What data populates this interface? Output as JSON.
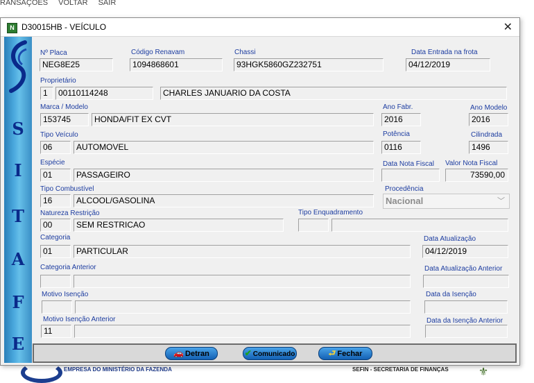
{
  "top_menu": [
    "RANSAÇÕES",
    "VOLTAR",
    "SAIR"
  ],
  "footer": {
    "left_text": "EMPRESA DO MINISTÉRIO DA FAZENDA",
    "right_text": "SEFIN - SECRETARIA DE FINANÇAS"
  },
  "window": {
    "icon_letter": "N",
    "title": "D30015HB - VEÍCULO",
    "close_symbol": "✕"
  },
  "sidebar": {
    "letters": [
      "S",
      "I",
      "T",
      "A",
      "F",
      "E"
    ]
  },
  "form": {
    "placa": {
      "label": "Nº Placa",
      "value": "NEG8E25"
    },
    "renavam": {
      "label": "Código Renavam",
      "value": "1094868601"
    },
    "chassi": {
      "label": "Chassi",
      "value": "93HGK5860GZ232751"
    },
    "data_entrada": {
      "label": "Data Entrada na frota",
      "value": "04/12/2019"
    },
    "proprietario": {
      "label": "Proprietário",
      "tipo": "1",
      "codigo": "00110114248",
      "nome": "CHARLES JANUARIO DA COSTA"
    },
    "marca_modelo": {
      "label": "Marca / Modelo",
      "codigo": "153745",
      "descricao": "HONDA/FIT EX CVT"
    },
    "ano_fabr": {
      "label": "Ano Fabr.",
      "value": "2016"
    },
    "ano_modelo": {
      "label": "Ano Modelo",
      "value": "2016"
    },
    "tipo_veiculo": {
      "label": "Tipo Veículo",
      "codigo": "06",
      "descricao": "AUTOMOVEL"
    },
    "potencia": {
      "label": "Potência",
      "value": "0116"
    },
    "cilindrada": {
      "label": "Cilindrada",
      "value": "1496"
    },
    "especie": {
      "label": "Espécie",
      "codigo": "01",
      "descricao": "PASSAGEIRO"
    },
    "data_nf": {
      "label": "Data Nota Fiscal",
      "value": ""
    },
    "valor_nf": {
      "label": "Valor Nota Fiscal",
      "value": "73590,00"
    },
    "combustivel": {
      "label": "Tipo Combustível",
      "codigo": "16",
      "descricao": "ALCOOL/GASOLINA"
    },
    "procedencia": {
      "label": "Procedência",
      "value": "Nacional"
    },
    "natureza_restricao": {
      "label": "Natureza Restrição",
      "codigo": "00",
      "descricao": "SEM RESTRICAO"
    },
    "tipo_enquadramento": {
      "label": "Tipo Enquadramento",
      "codigo": "",
      "descricao": ""
    },
    "categoria": {
      "label": "Categoria",
      "codigo": "01",
      "descricao": "PARTICULAR"
    },
    "data_atualizacao": {
      "label": "Data Atualização",
      "value": "04/12/2019"
    },
    "categoria_anterior": {
      "label": "Categoria Anterior",
      "codigo": "",
      "descricao": ""
    },
    "data_atualizacao_anterior": {
      "label": "Data Atualização Anterior",
      "value": ""
    },
    "motivo_isencao": {
      "label": "Motivo Isenção",
      "codigo": "",
      "descricao": ""
    },
    "data_isencao": {
      "label": "Data da Isenção",
      "value": ""
    },
    "motivo_isencao_anterior": {
      "label": "Motivo Isenção Anterior",
      "codigo": "11",
      "descricao": ""
    },
    "data_isencao_anterior": {
      "label": "Data da Isenção Anterior",
      "value": ""
    }
  },
  "buttons": {
    "detran": {
      "label": "Detran",
      "icon": "car-icon"
    },
    "comunicado": {
      "label": "Comunicado",
      "icon": "checkmark-icon"
    },
    "fechar": {
      "label": "Fechar",
      "icon": "door-exit-icon"
    }
  }
}
